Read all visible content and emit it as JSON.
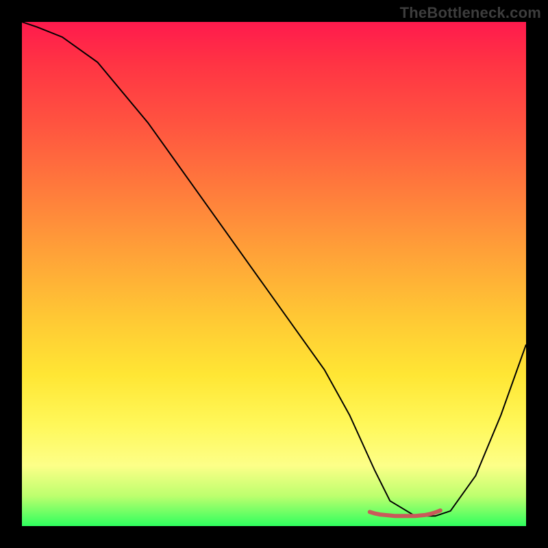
{
  "watermark": "TheBottleneck.com",
  "chart_data": {
    "type": "line",
    "title": "",
    "xlabel": "",
    "ylabel": "",
    "xlim": [
      0,
      100
    ],
    "ylim": [
      0,
      100
    ],
    "grid": false,
    "legend": false,
    "background_gradient_stops": [
      {
        "pct": 0,
        "color": "#ff1a4d"
      },
      {
        "pct": 8,
        "color": "#ff3344"
      },
      {
        "pct": 20,
        "color": "#ff5340"
      },
      {
        "pct": 33,
        "color": "#ff7a3c"
      },
      {
        "pct": 46,
        "color": "#ffa238"
      },
      {
        "pct": 59,
        "color": "#ffc934"
      },
      {
        "pct": 70,
        "color": "#ffe634"
      },
      {
        "pct": 80,
        "color": "#fff85a"
      },
      {
        "pct": 88,
        "color": "#fdff88"
      },
      {
        "pct": 94,
        "color": "#bdff6e"
      },
      {
        "pct": 100,
        "color": "#2fff5e"
      }
    ],
    "series": [
      {
        "name": "bottleneck-curve",
        "stroke": "#000000",
        "stroke_width": 2,
        "x": [
          0,
          3,
          8,
          15,
          25,
          35,
          45,
          55,
          60,
          65,
          70,
          73,
          78,
          82,
          85,
          90,
          95,
          100
        ],
        "values": [
          100,
          99,
          97,
          92,
          80,
          66,
          52,
          38,
          31,
          22,
          11,
          5,
          2,
          2,
          3,
          10,
          22,
          36
        ]
      },
      {
        "name": "optimal-range-marker",
        "stroke": "#c95a5a",
        "stroke_width": 6,
        "x": [
          69,
          70,
          71,
          72,
          73,
          74,
          75,
          76,
          77,
          78,
          79,
          80,
          81,
          82,
          83
        ],
        "values": [
          2.8,
          2.5,
          2.3,
          2.2,
          2.1,
          2.0,
          2.0,
          2.0,
          2.0,
          2.0,
          2.1,
          2.2,
          2.4,
          2.7,
          3.1
        ]
      }
    ]
  }
}
